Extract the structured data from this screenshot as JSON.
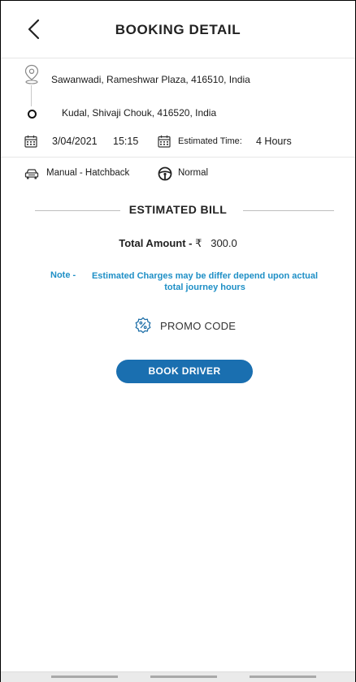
{
  "header": {
    "title": "BOOKING DETAIL"
  },
  "trip": {
    "pickup": "Sawanwadi, Rameshwar Plaza, 416510, India",
    "drop": "Kudal, Shivaji Chouk, 416520, India",
    "date": "3/04/2021",
    "time": "15:15",
    "estimated_label": "Estimated Time:",
    "estimated_value": "4 Hours"
  },
  "vehicle": {
    "type": "Manual - Hatchback",
    "mode": "Normal"
  },
  "bill": {
    "section_title": "ESTIMATED BILL",
    "total_label": "Total Amount - ",
    "currency": "₹",
    "total_value": "300.0",
    "note_label": "Note -",
    "note_text": "Estimated Charges may be differ depend upon actual total journey hours"
  },
  "promo": {
    "label": "PROMO CODE"
  },
  "actions": {
    "book_label": "BOOK DRIVER"
  },
  "colors": {
    "accent": "#1a6fb0",
    "note": "#1e8fc6"
  },
  "icons": {
    "back": "chevron-left-icon",
    "pickup": "location-pin-icon",
    "drop": "destination-dot-icon",
    "calendar": "calendar-icon",
    "car": "car-icon",
    "steering": "steering-wheel-icon",
    "promo": "discount-badge-icon"
  }
}
